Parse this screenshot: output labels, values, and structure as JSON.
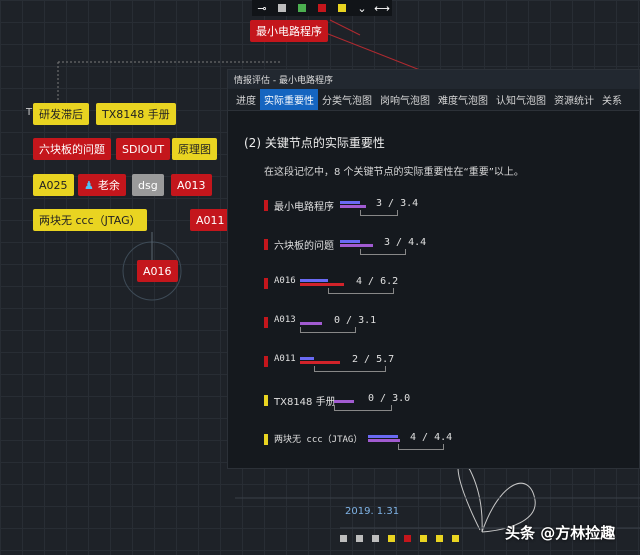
{
  "toolbar": {
    "icons": [
      "pin-icon",
      "gray-square",
      "green-square",
      "red-square",
      "yellow-square",
      "chevron-down-icon",
      "swap-arrows-icon"
    ],
    "colors": {
      "gray": "#bdbdbd",
      "green": "#4caf50",
      "red": "#c4161c",
      "yellow": "#e9d421"
    }
  },
  "graph": {
    "root": "最小电路程序",
    "small_label": "T",
    "nodes": {
      "n1": "研发滞后",
      "n2": "TX8148 手册",
      "n3": "六块板的问题",
      "n4": "SDIOUT",
      "n5": "原理图",
      "n6": "A025",
      "n7": "老余",
      "n8": "dsg",
      "n9": "A013",
      "n10": "两块无 ccc（JTAG）",
      "n11": "A011",
      "n12": "A016"
    }
  },
  "panel": {
    "title": "情报评估 - 最小电路程序",
    "tabs": [
      "进度",
      "实际重要性",
      "分类气泡图",
      "岗响气泡图",
      "难度气泡图",
      "认知气泡图",
      "资源统计",
      "关系"
    ],
    "active_tab": 1,
    "heading": "(2) 关键节点的实际重要性",
    "description": "在这段记忆中，8 个关键节点的实际重要性在“重要”以上。",
    "items": [
      {
        "label": "最小电路程序",
        "score": "3 / 3.4",
        "marker": "#c4161c"
      },
      {
        "label": "六块板的问题",
        "score": "3 / 4.4",
        "marker": "#c4161c"
      },
      {
        "label": "A016",
        "score": "4 / 6.2",
        "marker": "#c4161c"
      },
      {
        "label": "A013",
        "score": "0 / 3.1",
        "marker": "#c4161c"
      },
      {
        "label": "A011",
        "score": "2 / 5.7",
        "marker": "#c4161c"
      },
      {
        "label": "TX8148 手册",
        "score": "0 / 3.0",
        "marker": "#e9d421"
      },
      {
        "label": "两块无 ccc（JTAG）",
        "score": "4 / 4.4",
        "marker": "#e9d421"
      }
    ]
  },
  "timeline": {
    "date": "2019. 1.31"
  },
  "watermark": "头条 @方林捡趣"
}
